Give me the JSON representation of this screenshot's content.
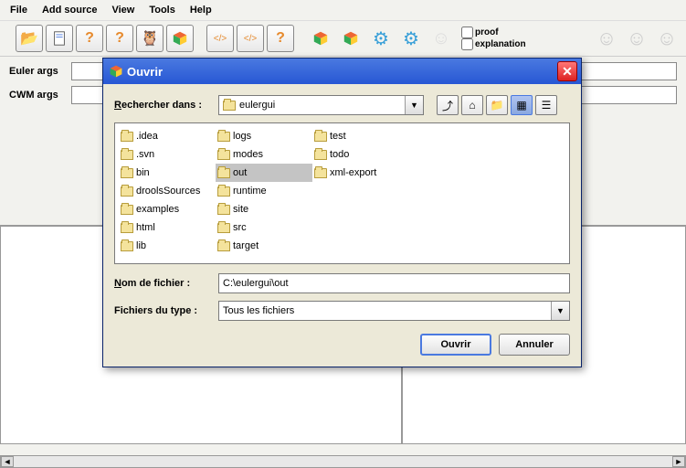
{
  "menu": {
    "file": "File",
    "add_source": "Add source",
    "view": "View",
    "tools": "Tools",
    "help": "Help"
  },
  "toolbar": {
    "open_icon": "📂",
    "doc_icon": "📄",
    "help_icon": "?",
    "proof_label": "proof",
    "explanation_label": "explanation"
  },
  "form": {
    "euler_label": "Euler args",
    "cwm_label": "CWM args",
    "euler_value": "",
    "cwm_value": ""
  },
  "dialog": {
    "title": "Ouvrir",
    "lookin_label_pre": "R",
    "lookin_label_post": "echercher dans :",
    "lookin_value": "eulergui",
    "filename_label_pre": "N",
    "filename_label_post": "om de fichier :",
    "filename_value": "C:\\eulergui\\out",
    "filetype_label": "Fichiers du type :",
    "filetype_value": "Tous les fichiers",
    "open_btn": "Ouvrir",
    "cancel_btn": "Annuler",
    "folders_col1": [
      ".idea",
      ".svn",
      "bin",
      "droolsSources",
      "examples",
      "html",
      "lib"
    ],
    "folders_col2": [
      "logs",
      "modes",
      "out",
      "runtime",
      "site",
      "src",
      "target"
    ],
    "folders_col3": [
      "test",
      "todo",
      "xml-export"
    ],
    "selected": "out"
  }
}
